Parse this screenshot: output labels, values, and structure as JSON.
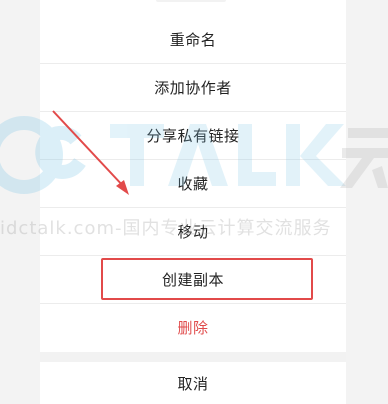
{
  "menu": {
    "items": [
      {
        "label": "重命名"
      },
      {
        "label": "添加协作者"
      },
      {
        "label": "分享私有链接"
      },
      {
        "label": "收藏"
      },
      {
        "label": "移动"
      },
      {
        "label": "创建副本"
      },
      {
        "label": "删除"
      }
    ],
    "cancel_label": "取消"
  },
  "watermark": {
    "logo_text": "OcTALK云",
    "line": "idctalk.com-国内专业云计算交流服务"
  },
  "colors": {
    "annotation_red": "#e24a4a",
    "delete_red": "#e04a4a",
    "watermark_blue": "#7fc7e8"
  }
}
